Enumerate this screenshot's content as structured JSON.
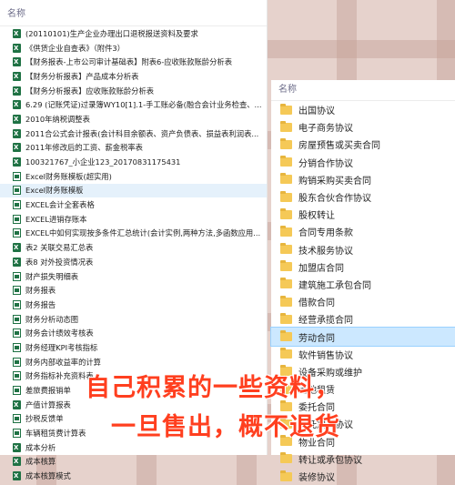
{
  "left_panel": {
    "column_header": "名称",
    "items": [
      {
        "label": "(20110101)生产企业办理出口退税报送资料及要求",
        "icon": "excel-icon"
      },
      {
        "label": "《供货企业自查表》（附件3）",
        "icon": "excel-icon"
      },
      {
        "label": "【财务报表-上市公司审计基础表】附表6-应收账款账龄分析表",
        "icon": "excel-icon"
      },
      {
        "label": "【财务分析报表】产品成本分析表",
        "icon": "excel-icon"
      },
      {
        "label": "【财务分析报表】应收账款账龄分析表",
        "icon": "excel-icon"
      },
      {
        "label": "6.29 (记账凭证)过录簿WY10[1].1-手工账必备(融合会计业务检查、...",
        "icon": "excel-icon"
      },
      {
        "label": "2010年纳税调整表",
        "icon": "excel-icon"
      },
      {
        "label": "2011合公式会计报表(会计科目余额表、资产负债表、损益表利润表...",
        "icon": "excel-icon"
      },
      {
        "label": "2011年修改后的工资、薪金税率表",
        "icon": "excel-icon"
      },
      {
        "label": "100321767_小企业123_20170831175431",
        "icon": "excel-icon"
      },
      {
        "label": "Excel财务账模板(超实用)",
        "icon": "excel-template-icon"
      },
      {
        "label": "Excel财务账模板",
        "icon": "excel-template-icon"
      },
      {
        "label": "EXCEL会计全套表格",
        "icon": "excel-template-icon"
      },
      {
        "label": "EXCEL进销存账本",
        "icon": "excel-template-icon"
      },
      {
        "label": "EXCEL中如何实现按多条件汇总统计(会计实例,两种方法,多函数应用...",
        "icon": "excel-template-icon"
      },
      {
        "label": "表2 关联交易汇总表",
        "icon": "excel-icon"
      },
      {
        "label": "表8 对外投资情况表",
        "icon": "excel-icon"
      },
      {
        "label": "财产损失明细表",
        "icon": "excel-template-icon"
      },
      {
        "label": "财务报表",
        "icon": "excel-template-icon"
      },
      {
        "label": "财务报告",
        "icon": "excel-template-icon"
      },
      {
        "label": "财务分析动态图",
        "icon": "excel-template-icon"
      },
      {
        "label": "财务会计绩效考核表",
        "icon": "excel-template-icon"
      },
      {
        "label": "财务经理KPI考核指标",
        "icon": "excel-template-icon"
      },
      {
        "label": "财务内部收益率的计算",
        "icon": "excel-template-icon"
      },
      {
        "label": "财务指标补充资料表",
        "icon": "excel-template-icon"
      },
      {
        "label": "差旅费报销单",
        "icon": "excel-template-icon"
      },
      {
        "label": "产值计算报表",
        "icon": "excel-icon"
      },
      {
        "label": "抄税反馈单",
        "icon": "excel-template-icon"
      },
      {
        "label": "车辆租赁费计算表",
        "icon": "excel-template-icon"
      },
      {
        "label": "成本分析",
        "icon": "excel-icon"
      },
      {
        "label": "成本核算",
        "icon": "excel-icon"
      },
      {
        "label": "成本核算模式",
        "icon": "excel-icon"
      }
    ],
    "selected_index": 11
  },
  "right_panel": {
    "column_header": "名称",
    "items": [
      {
        "label": "出国协议"
      },
      {
        "label": "电子商务协议"
      },
      {
        "label": "房屋预售或买卖合同"
      },
      {
        "label": "分销合作协议"
      },
      {
        "label": "购销采购买卖合同"
      },
      {
        "label": "股东合伙合作协议"
      },
      {
        "label": "股权转让"
      },
      {
        "label": "合同专用条款"
      },
      {
        "label": "技术服务协议"
      },
      {
        "label": "加盟店合同"
      },
      {
        "label": "建筑施工承包合同"
      },
      {
        "label": "借款合同"
      },
      {
        "label": "经营承揽合同"
      },
      {
        "label": "劳动合同"
      },
      {
        "label": "软件销售协议"
      },
      {
        "label": "设备采购或维护"
      },
      {
        "label": "土地租赁"
      },
      {
        "label": "委托合同"
      },
      {
        "label": "委托加工协议"
      },
      {
        "label": "物业合同"
      },
      {
        "label": "转让或承包协议"
      },
      {
        "label": "装修协议"
      }
    ],
    "selected_index": 13,
    "icon": "folder-icon"
  },
  "overlay": {
    "line1": "自己积累的一些资料，",
    "line2": "一旦售出，概不退货",
    "color": "#ff3f1f"
  },
  "colors": {
    "excel_green": "#1f7244",
    "folder_yellow": "#f5c957",
    "selection_blue": "#cce8ff"
  }
}
